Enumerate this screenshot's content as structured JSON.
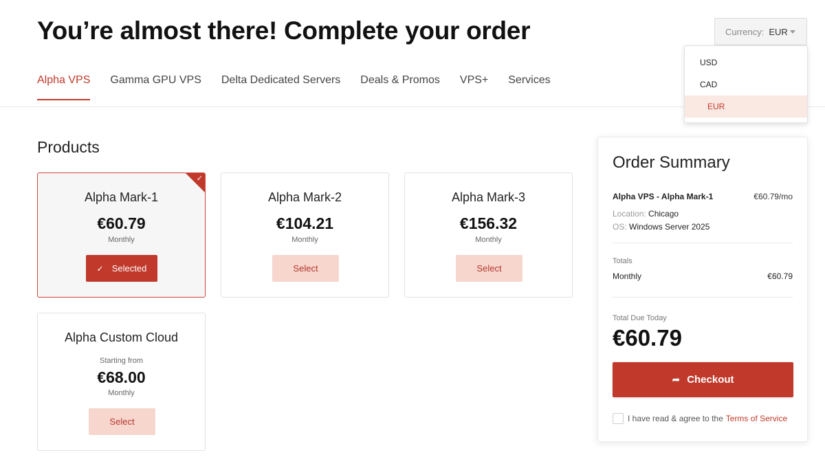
{
  "page": {
    "title": "You’re almost there! Complete your order"
  },
  "currency": {
    "label": "Currency:",
    "selected": "EUR",
    "options": [
      "USD",
      "CAD",
      "EUR"
    ]
  },
  "tabs": [
    {
      "label": "Alpha VPS",
      "active": true
    },
    {
      "label": "Gamma GPU VPS",
      "active": false
    },
    {
      "label": "Delta Dedicated Servers",
      "active": false
    },
    {
      "label": "Deals & Promos",
      "active": false
    },
    {
      "label": "VPS+",
      "active": false
    },
    {
      "label": "Services",
      "active": false
    }
  ],
  "products": {
    "title": "Products",
    "items": [
      {
        "name": "Alpha Mark-1",
        "price": "€60.79",
        "cycle": "Monthly",
        "button": "Selected",
        "selected": true
      },
      {
        "name": "Alpha Mark-2",
        "price": "€104.21",
        "cycle": "Monthly",
        "button": "Select",
        "selected": false
      },
      {
        "name": "Alpha Mark-3",
        "price": "€156.32",
        "cycle": "Monthly",
        "button": "Select",
        "selected": false
      },
      {
        "name": "Alpha Custom Cloud",
        "prefix": "Starting from",
        "price": "€68.00",
        "cycle": "Monthly",
        "button": "Select",
        "selected": false
      }
    ]
  },
  "summary": {
    "title": "Order Summary",
    "item_name": "Alpha VPS - Alpha Mark-1",
    "item_price": "€60.79/mo",
    "location_label": "Location:",
    "location_value": "Chicago",
    "os_label": "OS:",
    "os_value": "Windows Server 2025",
    "totals_label": "Totals",
    "monthly_label": "Monthly",
    "monthly_value": "€60.79",
    "due_label": "Total Due Today",
    "due_value": "€60.79",
    "checkout_label": "Checkout",
    "tos_text": "I have read & agree to the",
    "tos_link": "Terms of Service"
  },
  "colors": {
    "accent": "#c0392b",
    "accent_light": "#f7d6ce"
  },
  "icons": {
    "checkout": "share-arrow-icon",
    "selected": "check-icon",
    "currency": "caret-down-icon"
  }
}
